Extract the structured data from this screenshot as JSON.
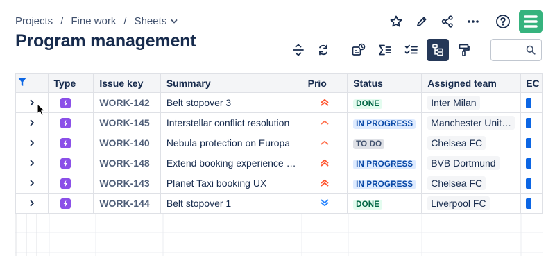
{
  "breadcrumb": {
    "items": [
      "Projects",
      "Fine work",
      "Sheets"
    ],
    "separator": "/"
  },
  "page": {
    "title": "Program management"
  },
  "top_actions": [
    "star-icon",
    "pencil-icon",
    "share-icon",
    "more-icon",
    "help-icon"
  ],
  "toolbar": {
    "buttons": [
      "collapse-rows-icon",
      "refresh-icon",
      "hierarchy-view-icon",
      "sum-icon",
      "checklist-icon",
      "tree-view-icon",
      "paint-roller-icon"
    ],
    "active": "tree-view-icon"
  },
  "search": {
    "value": "",
    "placeholder": ""
  },
  "table": {
    "columns": [
      "Type",
      "Issue key",
      "Summary",
      "Prio",
      "Status",
      "Assigned team",
      "EC"
    ],
    "rows": [
      {
        "key": "WORK-142",
        "summary": "Belt stopover 3",
        "prio": "high",
        "status": "DONE",
        "team": "Inter Milan"
      },
      {
        "key": "WORK-145",
        "summary": "Interstellar conflict resolution",
        "prio": "medium",
        "status": "IN PROGRESS",
        "team": "Manchester Unit…"
      },
      {
        "key": "WORK-140",
        "summary": "Nebula protection on Europa",
        "prio": "medium",
        "status": "TO DO",
        "team": "Chelsea FC"
      },
      {
        "key": "WORK-148",
        "summary": "Extend booking experience …",
        "prio": "high",
        "status": "IN PROGRESS",
        "team": "BVB Dortmund"
      },
      {
        "key": "WORK-143",
        "summary": "Planet Taxi booking UX",
        "prio": "high",
        "status": "IN PROGRESS",
        "team": "Chelsea FC"
      },
      {
        "key": "WORK-144",
        "summary": "Belt stopover 1",
        "prio": "low",
        "status": "DONE",
        "team": "Liverpool FC"
      }
    ]
  },
  "colors": {
    "status_done": {
      "bg": "#e3fcef",
      "fg": "#006644"
    },
    "status_in_progress": {
      "bg": "#deebff",
      "fg": "#0747a6"
    },
    "status_to_do": {
      "bg": "#dfe1e6",
      "fg": "#42526e"
    },
    "prio_high": "#ff5630",
    "prio_medium": "#ff7452",
    "prio_low": "#2684ff",
    "type_icon": "#8b50e8",
    "ec_bar": "#0c66e4",
    "logo": "#36b37e"
  }
}
